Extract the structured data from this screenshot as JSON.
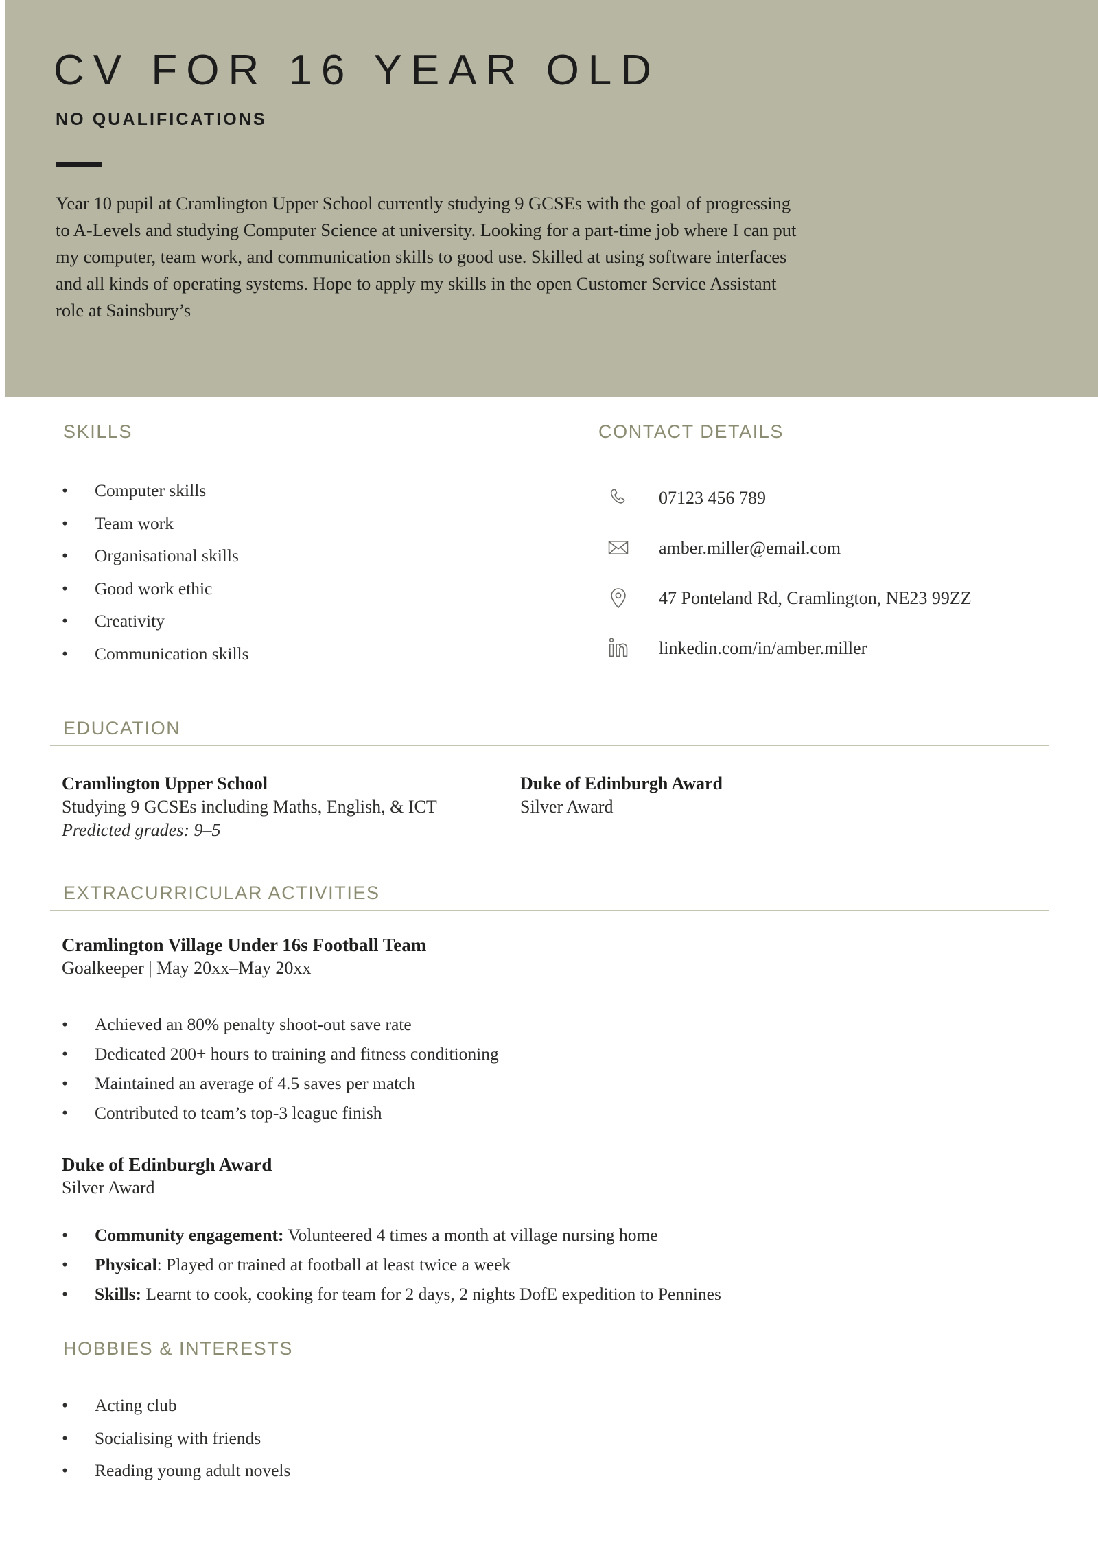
{
  "header": {
    "title": "CV FOR 16 YEAR OLD",
    "subtitle": "NO QUALIFICATIONS",
    "summary": "Year 10 pupil at Cramlington Upper School currently studying 9 GCSEs with the goal of progressing to A-Levels and studying Computer Science at university. Looking for a part-time job where I can put my computer, team work, and communication skills to good use. Skilled at using software interfaces and all kinds of operating systems. Hope to apply my skills in the open Customer Service Assistant role at Sainsbury’s",
    "band_color": "#b7b6a3"
  },
  "theme": {
    "accent": "#8c8c72",
    "rule": "#c6c5b4",
    "text": "#2e2e2c"
  },
  "skills": {
    "heading": "SKILLS",
    "items": [
      "Computer skills",
      "Team work",
      "Organisational skills",
      "Good work ethic",
      "Creativity",
      "Communication skills"
    ]
  },
  "contact": {
    "heading": "CONTACT DETAILS",
    "items": [
      {
        "icon": "phone-icon",
        "value": "07123 456 789"
      },
      {
        "icon": "envelope-icon",
        "value": "amber.miller@email.com"
      },
      {
        "icon": "location-pin-icon",
        "value": "47 Ponteland Rd, Cramlington, NE23 99ZZ"
      },
      {
        "icon": "linkedin-icon",
        "value": "linkedin.com/in/amber.miller"
      }
    ]
  },
  "education": {
    "heading": "EDUCATION",
    "entries": [
      {
        "title": "Cramlington Upper School",
        "subtitle": "Studying 9 GCSEs including Maths, English, & ICT",
        "note": "Predicted grades: 9–5"
      },
      {
        "title": "Duke of Edinburgh Award",
        "subtitle": "Silver Award",
        "note": ""
      }
    ]
  },
  "extracurricular": {
    "heading": "EXTRACURRICULAR ACTIVITIES",
    "entries": [
      {
        "title": "Cramlington Village Under 16s Football Team",
        "subtitle": "Goalkeeper | May 20xx–May 20xx",
        "bullets": [
          {
            "lead": "",
            "rest": "Achieved an 80% penalty shoot-out save rate"
          },
          {
            "lead": "",
            "rest": "Dedicated 200+ hours to training and fitness conditioning"
          },
          {
            "lead": "",
            "rest": "Maintained an average of 4.5 saves per match"
          },
          {
            "lead": "",
            "rest": "Contributed to team’s top-3 league finish"
          }
        ]
      },
      {
        "title": "Duke of Edinburgh Award",
        "subtitle": "Silver Award",
        "bullets": [
          {
            "lead": "Community engagement:",
            "rest": " Volunteered 4 times a month at village nursing home"
          },
          {
            "lead": "Physical",
            "rest": ": Played or trained at football at least twice a week"
          },
          {
            "lead": "Skills:",
            "rest": " Learnt to cook, cooking for team for 2 days, 2 nights DofE expedition to Pennines"
          }
        ]
      }
    ]
  },
  "hobbies": {
    "heading": "HOBBIES & INTERESTS",
    "items": [
      "Acting club",
      "Socialising with friends",
      "Reading young adult novels"
    ]
  }
}
